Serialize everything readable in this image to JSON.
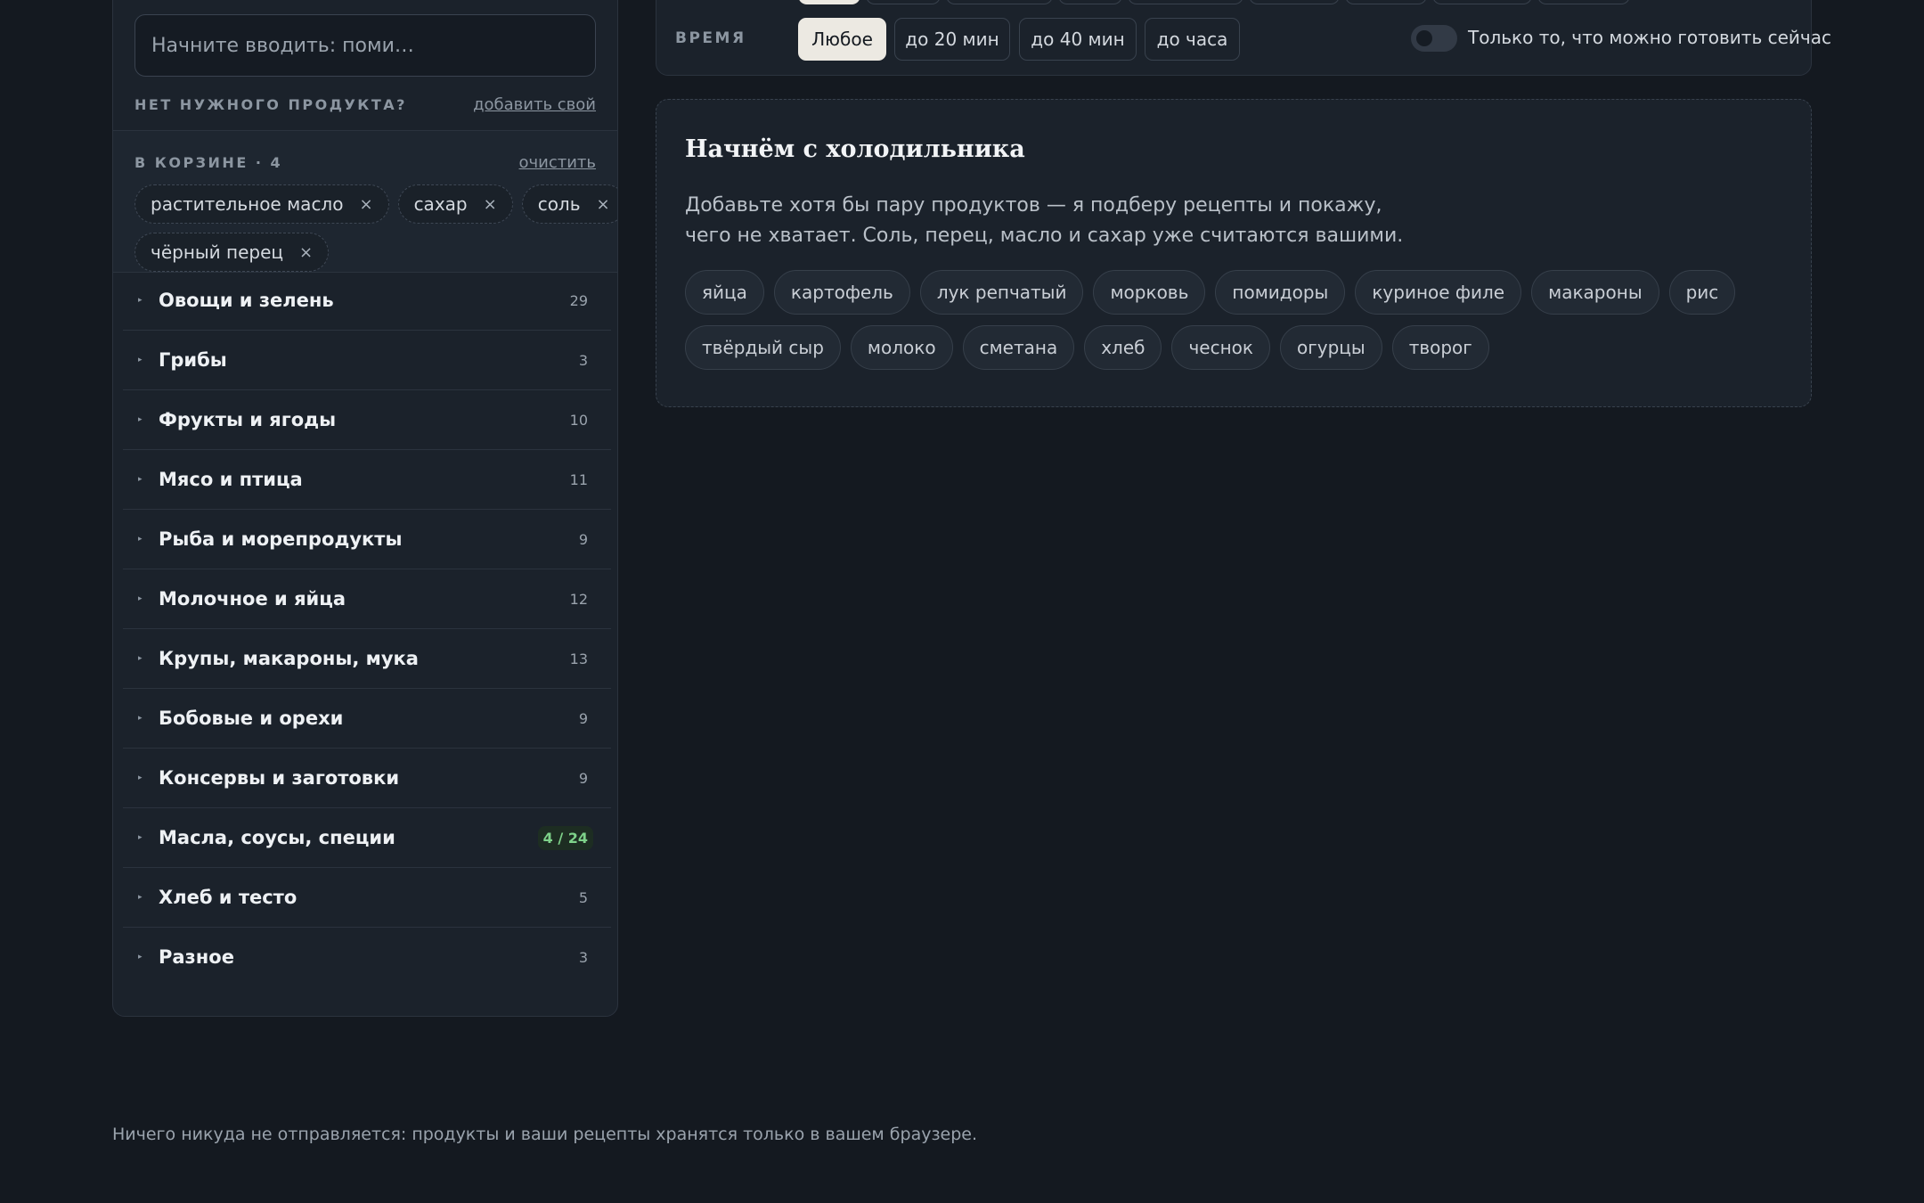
{
  "search": {
    "placeholder": "Начните вводить: поми…"
  },
  "missing": {
    "label": "НЕТ НУЖНОГО ПРОДУКТА?",
    "add_link": "добавить свой"
  },
  "cart": {
    "title": "В КОРЗИНЕ · 4",
    "clear_link": "очистить",
    "items": [
      {
        "label": "растительное масло"
      },
      {
        "label": "сахар"
      },
      {
        "label": "соль"
      },
      {
        "label": "чёрный перец"
      }
    ],
    "remove_glyph": "×"
  },
  "categories": [
    {
      "name": "Овощи и зелень",
      "count": "29"
    },
    {
      "name": "Грибы",
      "count": "3"
    },
    {
      "name": "Фрукты и ягоды",
      "count": "10"
    },
    {
      "name": "Мясо и птица",
      "count": "11"
    },
    {
      "name": "Рыба и морепродукты",
      "count": "9"
    },
    {
      "name": "Молочное и яйца",
      "count": "12"
    },
    {
      "name": "Крупы, макароны, мука",
      "count": "13"
    },
    {
      "name": "Бобовые и орехи",
      "count": "9"
    },
    {
      "name": "Консервы и заготовки",
      "count": "9"
    },
    {
      "name": "Масла, соусы, специи",
      "count": "4 / 24"
    },
    {
      "name": "Хлеб и тесто",
      "count": "5"
    },
    {
      "name": "Разное",
      "count": "3"
    }
  ],
  "filters": {
    "time_label": "ВРЕМЯ",
    "time_options": [
      "Любое",
      "до 20 мин",
      "до 40 мин",
      "до часа"
    ],
    "toggle_label": "Только то, что можно готовить сейчас"
  },
  "empty_state": {
    "title": "Начнём с холодильника",
    "text": "Добавьте хотя бы пару продуктов — я подберу рецепты и покажу, чего не хватает. Соль, перец, масло и сахар уже считаются вашими.",
    "suggestions_row1": [
      "яйца",
      "картофель",
      "лук репчатый",
      "морковь",
      "помидоры",
      "куриное филе",
      "макароны",
      "рис"
    ],
    "suggestions_row2": [
      "твёрдый сыр",
      "молоко",
      "сметана",
      "хлеб",
      "чеснок",
      "огурцы",
      "творог"
    ]
  },
  "footer": {
    "text": "Ничего никуда не отправляется: продукты и ваши рецепты хранятся только в вашем браузере."
  },
  "colors": {
    "accent_count": "#7ed28a",
    "active_button": "#ece9e2",
    "background": "#141920"
  }
}
